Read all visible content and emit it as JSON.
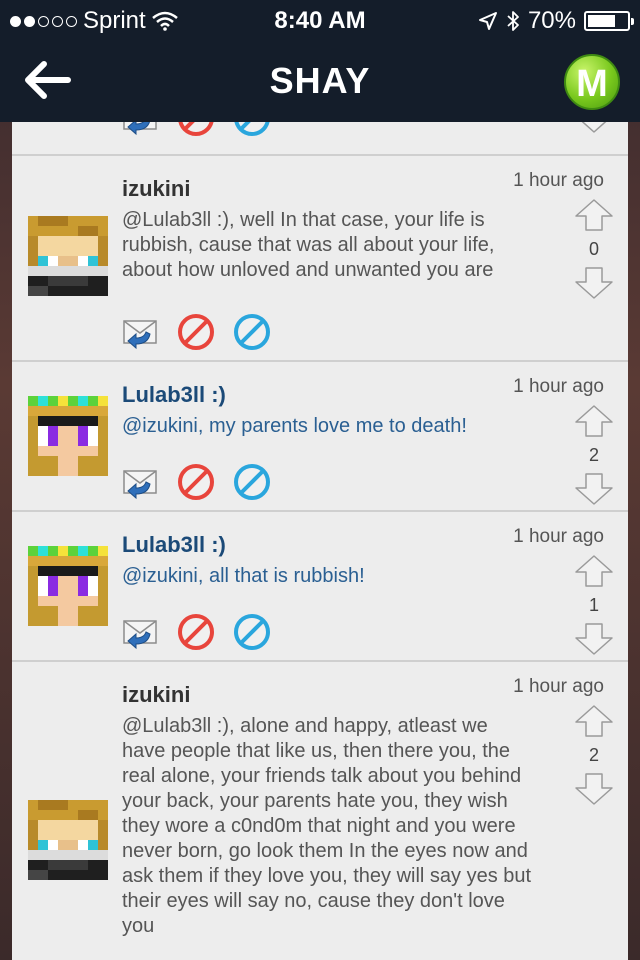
{
  "status_bar": {
    "carrier": "Sprint",
    "time": "8:40 AM",
    "battery_percent": "70%",
    "battery_level": 0.7
  },
  "nav": {
    "title": "SHAY",
    "logo_letter": "M"
  },
  "colors": {
    "bar": "#141d2a",
    "panel": "#ededed",
    "link_blue": "#1b4a78",
    "block_red": "#e8453c",
    "block_blue": "#2aa6dd"
  },
  "posts": [
    {
      "author": "izukini",
      "time": "1 hour ago",
      "message": "@Lulab3ll :), well In that case, your life is rubbish, cause that was all about your life, about how unloved and unwanted you are",
      "votes": "0",
      "avatar": "blond-skin-icon"
    },
    {
      "author": "Lulab3ll :)",
      "time": "1 hour ago",
      "message": "@izukini, my parents love me to death!",
      "votes": "2",
      "avatar": "flower-crown-skin-icon"
    },
    {
      "author": "Lulab3ll :)",
      "time": "1 hour ago",
      "message": "@izukini, all that is rubbish!",
      "votes": "1",
      "avatar": "flower-crown-skin-icon"
    },
    {
      "author": "izukini",
      "time": "1 hour ago",
      "message": "@Lulab3ll :), alone and happy, atleast we have people that like us, then there you, the real alone, your friends talk about you behind your back, your parents hate you, they wish they wore a c0nd0m that night and you were never born, go look them In the eyes now and ask them if they love you, they will say yes but their eyes will say no, cause they don't love you",
      "votes": "2",
      "avatar": "blond-skin-icon"
    }
  ]
}
